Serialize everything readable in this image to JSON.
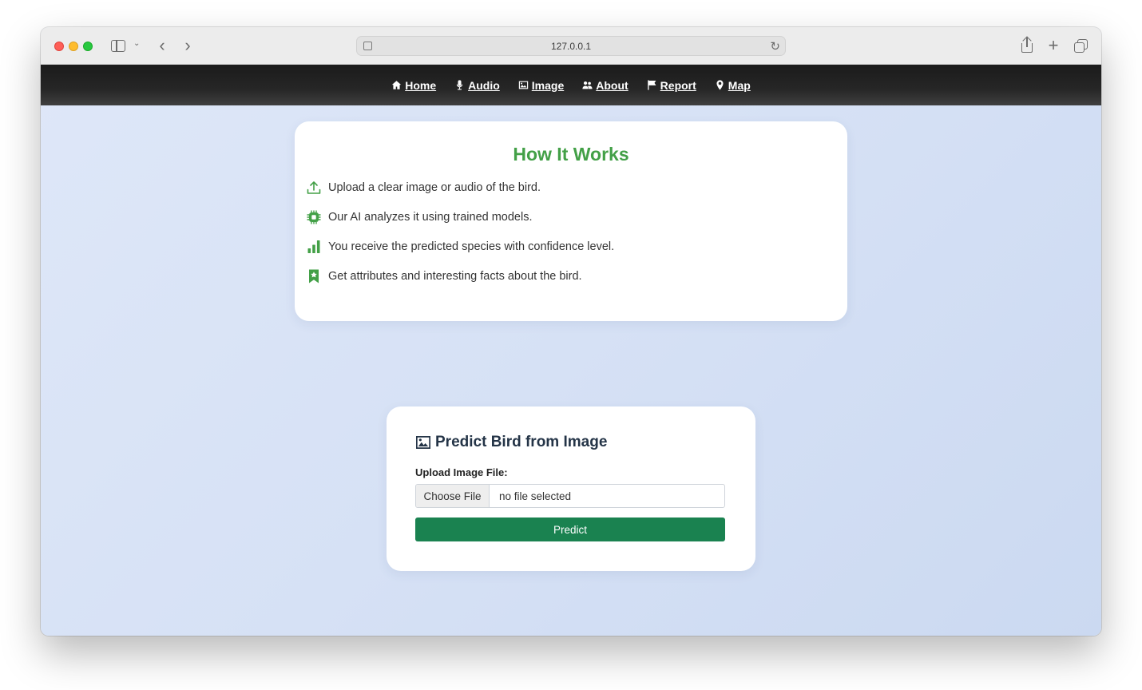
{
  "browser": {
    "url": "127.0.0.1"
  },
  "nav": {
    "items": [
      {
        "label": "Home",
        "icon": "home-icon"
      },
      {
        "label": "Audio",
        "icon": "microphone-icon"
      },
      {
        "label": "Image",
        "icon": "image-icon"
      },
      {
        "label": "About",
        "icon": "users-icon"
      },
      {
        "label": "Report",
        "icon": "flag-icon"
      },
      {
        "label": "Map",
        "icon": "map-pin-icon"
      }
    ]
  },
  "how_it_works": {
    "title": "How It Works",
    "steps": [
      {
        "text": "Upload a clear image or audio of the bird.",
        "icon": "upload-icon"
      },
      {
        "text": "Our AI analyzes it using trained models.",
        "icon": "chip-icon"
      },
      {
        "text": "You receive the predicted species with confidence level.",
        "icon": "bar-chart-icon"
      },
      {
        "text": "Get attributes and interesting facts about the bird.",
        "icon": "bookmark-icon"
      }
    ]
  },
  "predict": {
    "title": "Predict Bird from Image",
    "upload_label": "Upload Image File:",
    "choose_file": "Choose File",
    "file_status": "no file selected",
    "button": "Predict"
  },
  "colors": {
    "accent_green": "#43a047",
    "button_green": "#1a8250",
    "navbar": "#1b1b1b"
  }
}
